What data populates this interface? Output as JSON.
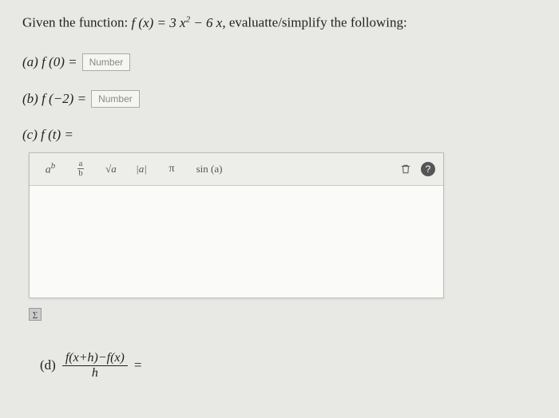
{
  "prompt": {
    "prefix": "Given the function:  ",
    "func": "f (x) = 3 x",
    "exp": "2",
    "rest": " − 6 x,",
    "suffix": "  evaluatte/simplify the following:"
  },
  "a": {
    "label": "(a)  f (0) = ",
    "placeholder": "Number"
  },
  "b": {
    "label": "(b)  f (−2) = ",
    "placeholder": "Number"
  },
  "c": {
    "label": "(c)  f (t) ="
  },
  "toolbar": {
    "power": "a",
    "power_exp": "b",
    "frac_n": "a",
    "frac_d": "b",
    "sqrt": "√a",
    "abs": "|a|",
    "pi": "π",
    "sin": "sin (a)"
  },
  "d": {
    "label": "(d)",
    "num": "f(x+h)−f(x)",
    "den": "h",
    "eq": "="
  }
}
